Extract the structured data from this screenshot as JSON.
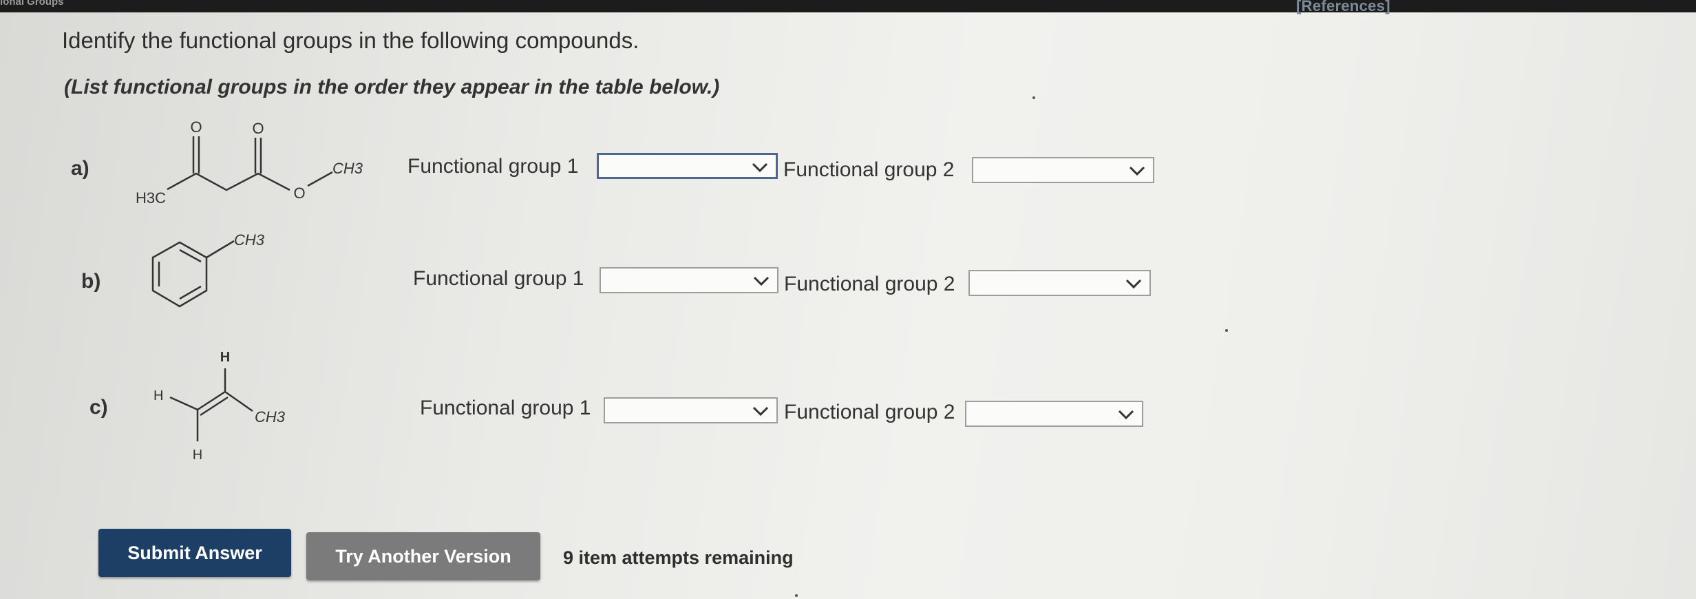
{
  "header": {
    "section_title": "ional Groups",
    "references_link": "[References]"
  },
  "question": {
    "prompt": "Identify the functional groups in the following compounds.",
    "instruction": "(List functional groups in the order they appear in the table below.)"
  },
  "compounds": [
    {
      "label": "a)",
      "structure_labels": {
        "left_group": "H3C",
        "oxygen_1": "O",
        "oxygen_2": "O",
        "ester_oxygen": "O",
        "right_group": "CH3"
      },
      "fg1_label": "Functional group 1",
      "fg1_value": "",
      "fg2_label": "Functional group 2",
      "fg2_value": ""
    },
    {
      "label": "b)",
      "structure_labels": {
        "substituent": "CH3"
      },
      "fg1_label": "Functional group 1",
      "fg1_value": "",
      "fg2_label": "Functional group 2",
      "fg2_value": ""
    },
    {
      "label": "c)",
      "structure_labels": {
        "top_h": "H",
        "left_h": "H",
        "bottom_h": "H",
        "substituent": "CH3"
      },
      "fg1_label": "Functional group 1",
      "fg1_value": "",
      "fg2_label": "Functional group 2",
      "fg2_value": ""
    }
  ],
  "actions": {
    "submit_label": "Submit Answer",
    "try_another_label": "Try Another Version",
    "attempts_text": "9 item attempts remaining"
  },
  "icons": {
    "dropdown": "chevron-down-icon"
  },
  "colors": {
    "submit_bg": "#1d3f66",
    "try_bg": "#7b7b7b",
    "focus_border": "#4f6790"
  }
}
